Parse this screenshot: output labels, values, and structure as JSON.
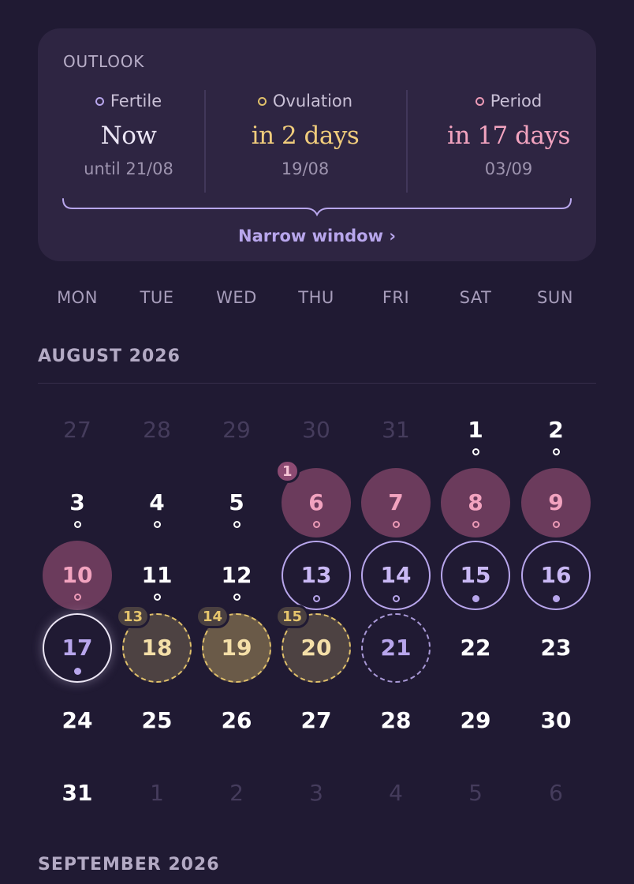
{
  "outlook": {
    "title": "OUTLOOK",
    "fertile": {
      "label": "Fertile",
      "value": "Now",
      "sub": "until 21/08"
    },
    "ovulation": {
      "label": "Ovulation",
      "value": "in 2 days",
      "sub": "19/08"
    },
    "period": {
      "label": "Period",
      "value": "in 17 days",
      "sub": "03/09"
    },
    "link": "Narrow window ›"
  },
  "weekdays": [
    "MON",
    "TUE",
    "WED",
    "THU",
    "FRI",
    "SAT",
    "SUN"
  ],
  "months": {
    "august": "AUGUST 2026",
    "september": "SEPTEMBER 2026"
  },
  "calendar": {
    "days": [
      {
        "n": "27",
        "state": "muted"
      },
      {
        "n": "28",
        "state": "muted"
      },
      {
        "n": "29",
        "state": "muted"
      },
      {
        "n": "30",
        "state": "muted"
      },
      {
        "n": "31",
        "state": "muted"
      },
      {
        "n": "1",
        "dot": "hollow"
      },
      {
        "n": "2",
        "dot": "hollow"
      },
      {
        "n": "3",
        "dot": "hollow"
      },
      {
        "n": "4",
        "dot": "hollow"
      },
      {
        "n": "5",
        "dot": "hollow"
      },
      {
        "n": "6",
        "state": "period",
        "dot": "hollow-pink",
        "badge": "1"
      },
      {
        "n": "7",
        "state": "period",
        "dot": "hollow-pink"
      },
      {
        "n": "8",
        "state": "period",
        "dot": "hollow-pink"
      },
      {
        "n": "9",
        "state": "period",
        "dot": "hollow-pink"
      },
      {
        "n": "10",
        "state": "period",
        "dot": "hollow-pink"
      },
      {
        "n": "11",
        "dot": "hollow"
      },
      {
        "n": "12",
        "dot": "hollow"
      },
      {
        "n": "13",
        "state": "fertile",
        "dot": "hollow-lav"
      },
      {
        "n": "14",
        "state": "fertile",
        "dot": "hollow-lav"
      },
      {
        "n": "15",
        "state": "fertile",
        "dot": "filled"
      },
      {
        "n": "16",
        "state": "fertile",
        "dot": "filled"
      },
      {
        "n": "17",
        "state": "today",
        "dot": "filled"
      },
      {
        "n": "18",
        "state": "ovulation",
        "badge": "13"
      },
      {
        "n": "19",
        "state": "ovulation-peak",
        "badge": "14"
      },
      {
        "n": "20",
        "state": "ovulation",
        "badge": "15"
      },
      {
        "n": "21",
        "state": "fertile-end"
      },
      {
        "n": "22"
      },
      {
        "n": "23"
      },
      {
        "n": "24"
      },
      {
        "n": "25"
      },
      {
        "n": "26"
      },
      {
        "n": "27"
      },
      {
        "n": "28"
      },
      {
        "n": "29"
      },
      {
        "n": "30"
      },
      {
        "n": "31"
      },
      {
        "n": "1",
        "state": "muted"
      },
      {
        "n": "2",
        "state": "muted"
      },
      {
        "n": "3",
        "state": "muted"
      },
      {
        "n": "4",
        "state": "muted"
      },
      {
        "n": "5",
        "state": "muted"
      },
      {
        "n": "6",
        "state": "muted"
      }
    ]
  },
  "colors": {
    "background": "#201a33",
    "fertile": "#b8a6ec",
    "ovulation": "#e0c06a",
    "period": "#ec9ab6"
  }
}
